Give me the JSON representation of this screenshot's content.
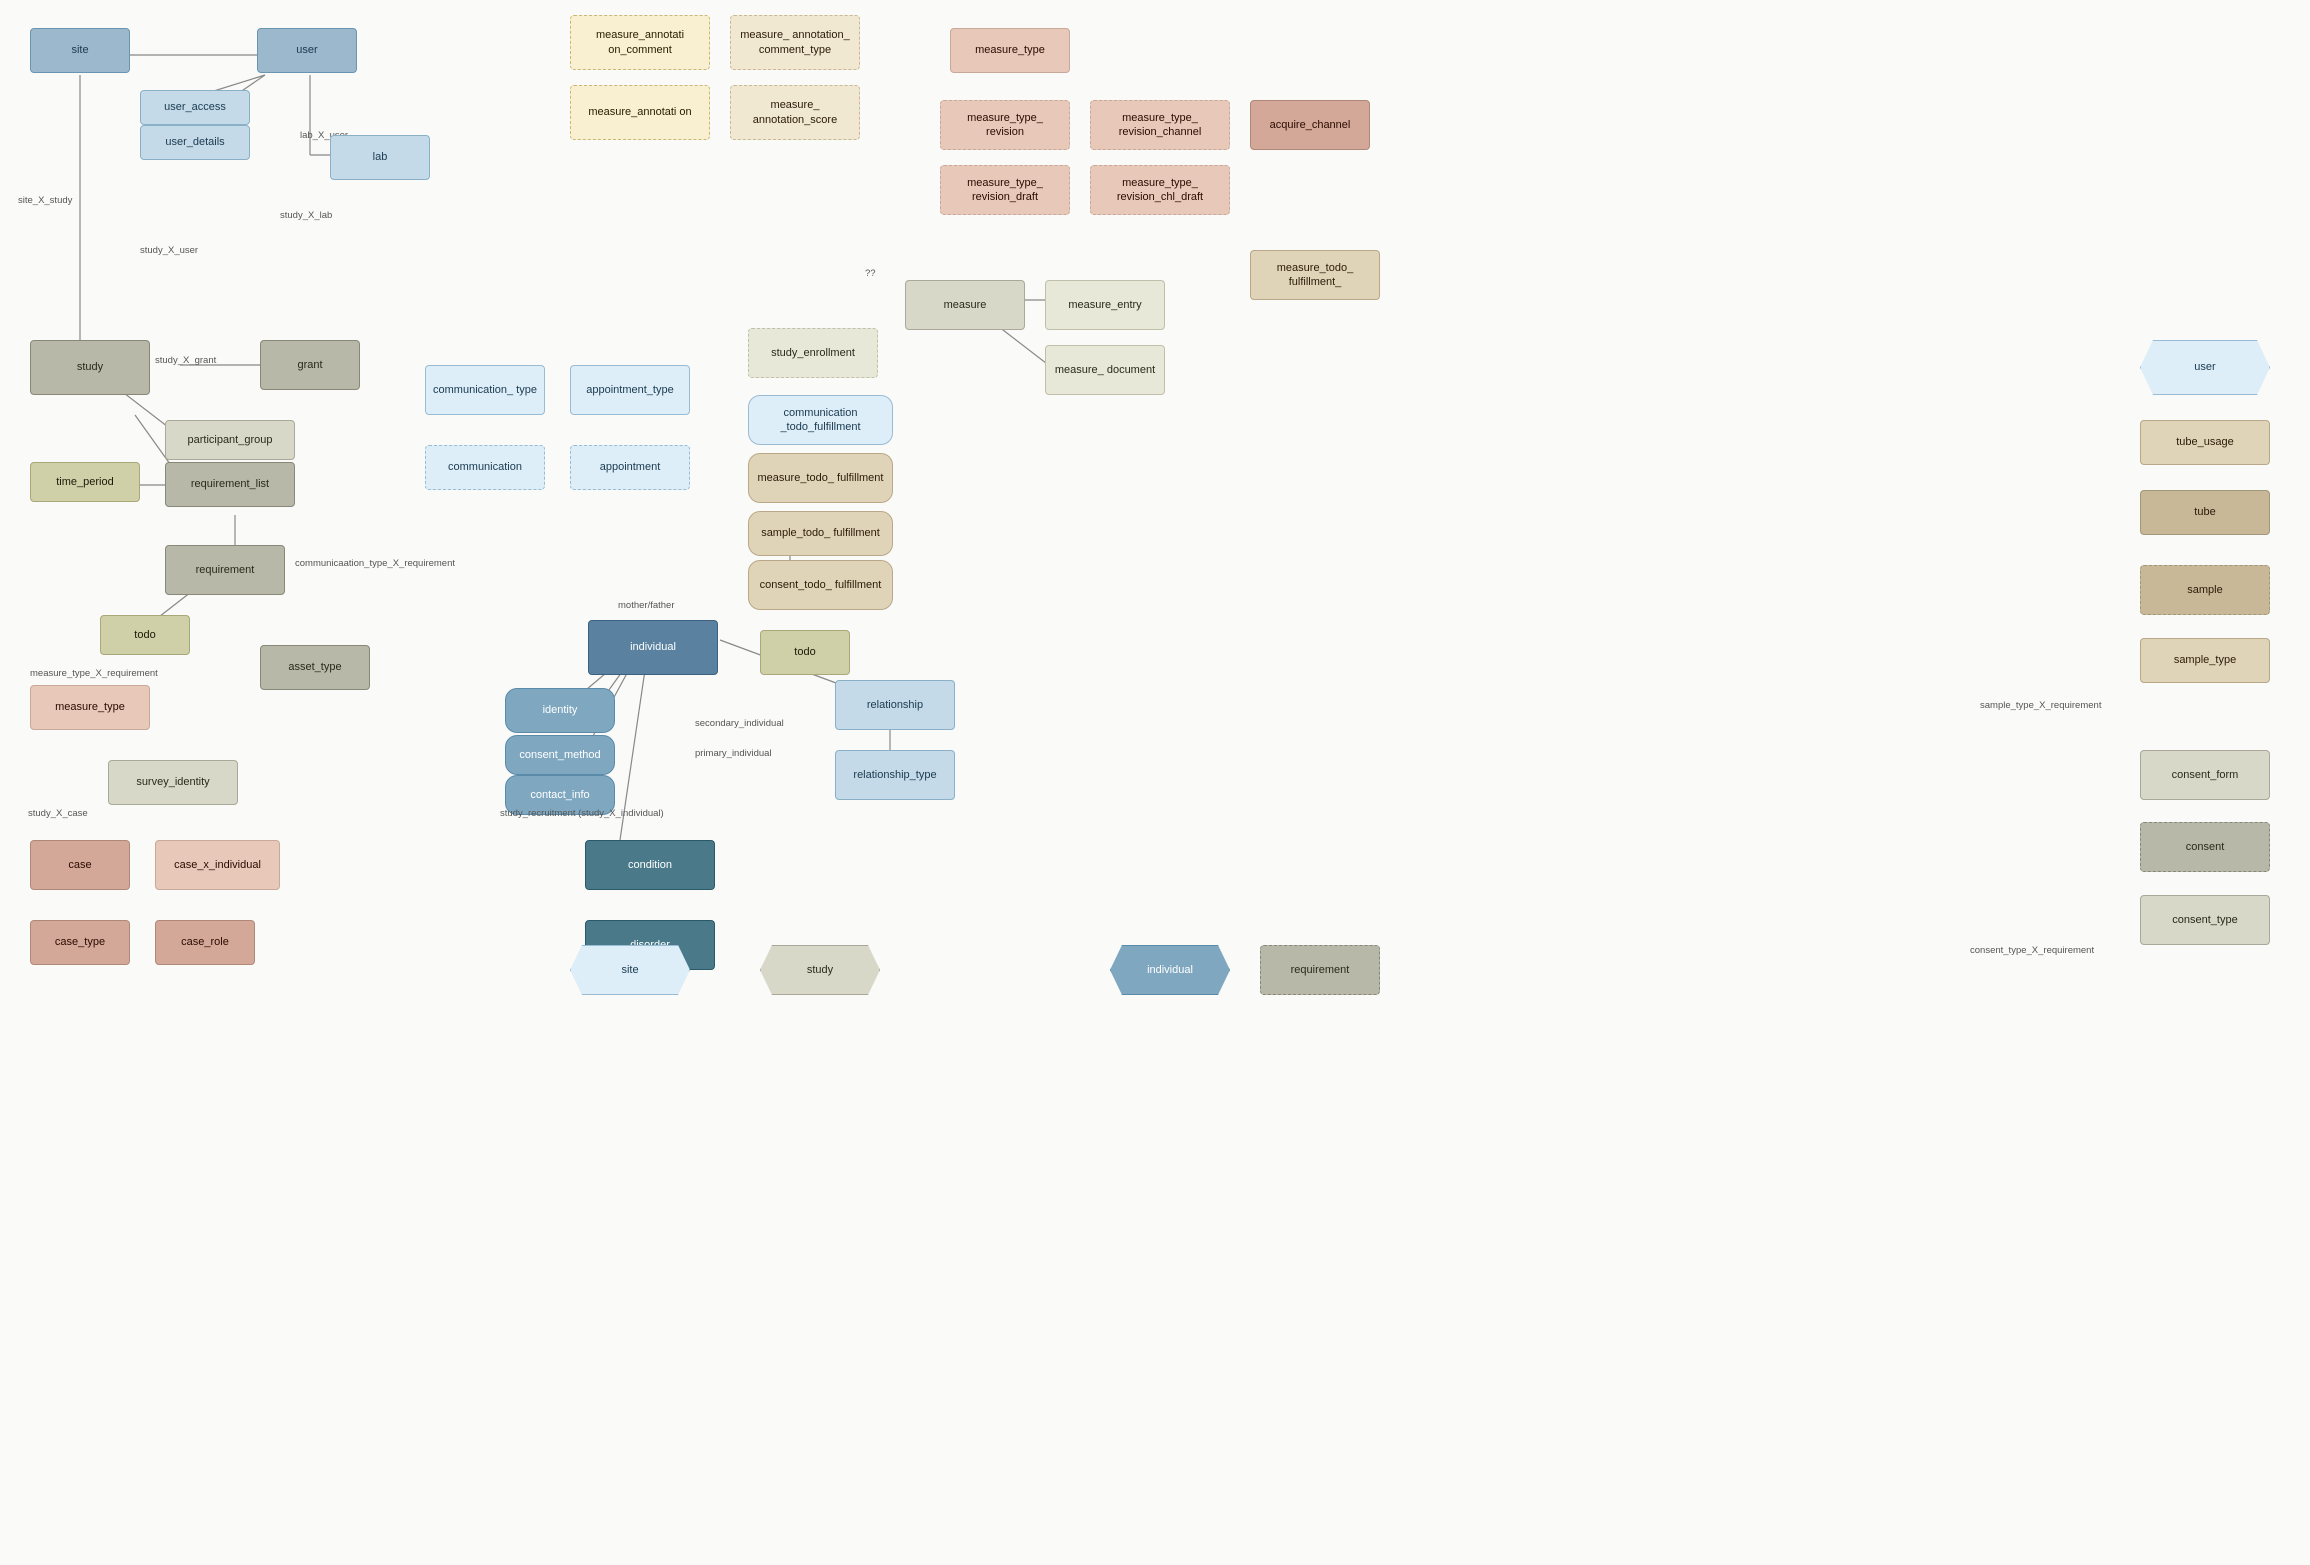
{
  "nodes": {
    "site": {
      "label": "site"
    },
    "user_top": {
      "label": "user"
    },
    "user_access": {
      "label": "user_access"
    },
    "user_details": {
      "label": "user_details"
    },
    "lab": {
      "label": "lab"
    },
    "measure_annotation_comment": {
      "label": "measure_annotati\non_comment"
    },
    "measure_annotation_comment_type": {
      "label": "measure_\nannotation_\ncomment_type"
    },
    "measure_annotation": {
      "label": "measure_annotati\non"
    },
    "measure_annotation_score": {
      "label": "measure_\nannotation_score"
    },
    "measure_type_top": {
      "label": "measure_type"
    },
    "measure_type_revision": {
      "label": "measure_type_\nrevision"
    },
    "measure_type_revision_channel": {
      "label": "measure_type_\nrevision_channel"
    },
    "acquire_channel": {
      "label": "acquire_channel"
    },
    "measure_type_revision_draft": {
      "label": "measure_type_\nrevision_draft"
    },
    "measure_type_revision_chl_draft": {
      "label": "measure_type_\nrevision_chl_draft"
    },
    "measure_todo_fulfillment_top": {
      "label": "measure_todo_\nfulfillment_"
    },
    "measure": {
      "label": "measure"
    },
    "measure_entry": {
      "label": "measure_entry"
    },
    "measure_document": {
      "label": "measure_\ndocument"
    },
    "study": {
      "label": "study"
    },
    "grant": {
      "label": "grant"
    },
    "participant_group": {
      "label": "participant_group"
    },
    "time_period": {
      "label": "time_period"
    },
    "requirement_list": {
      "label": "requirement_list"
    },
    "requirement": {
      "label": "requirement"
    },
    "todo_left": {
      "label": "todo"
    },
    "measure_type_left": {
      "label": "measure_type"
    },
    "asset_type": {
      "label": "asset_type"
    },
    "communication_type": {
      "label": "communication_\ntype"
    },
    "communication": {
      "label": "communication"
    },
    "appointment_type": {
      "label": "appointment_type"
    },
    "appointment": {
      "label": "appointment"
    },
    "study_enrollment": {
      "label": "study_enrollment"
    },
    "communication_todo_fulfillment": {
      "label": "communication\n_todo_fulfillment"
    },
    "measure_todo_fulfillment_center": {
      "label": "measure_todo_\nfulfillment"
    },
    "sample_todo_fulfillment": {
      "label": "sample_todo_\nfulfillment"
    },
    "consent_todo_fulfillment": {
      "label": "consent_todo_\nfulfillment"
    },
    "todo_center": {
      "label": "todo"
    },
    "individual": {
      "label": "individual"
    },
    "identity": {
      "label": "identity"
    },
    "consent_method": {
      "label": "consent_method"
    },
    "contact_info": {
      "label": "contact_info"
    },
    "relationship": {
      "label": "relationship"
    },
    "relationship_type": {
      "label": "relationship_type"
    },
    "condition": {
      "label": "condition"
    },
    "disorder": {
      "label": "disorder"
    },
    "site_legend": {
      "label": "site"
    },
    "study_legend": {
      "label": "study"
    },
    "individual_legend": {
      "label": "individual"
    },
    "requirement_legend": {
      "label": "requirement"
    },
    "survey_identity": {
      "label": "survey_identity"
    },
    "case": {
      "label": "case"
    },
    "case_x_individual": {
      "label": "case_x_individual"
    },
    "case_type": {
      "label": "case_type"
    },
    "case_role": {
      "label": "case_role"
    },
    "user_right": {
      "label": "user"
    },
    "tube_usage": {
      "label": "tube_usage"
    },
    "tube": {
      "label": "tube"
    },
    "sample": {
      "label": "sample"
    },
    "sample_type": {
      "label": "sample_type"
    },
    "consent_form": {
      "label": "consent_form"
    },
    "consent": {
      "label": "consent"
    },
    "consent_type": {
      "label": "consent_type"
    }
  },
  "labels": {
    "lab_x_user": "lab_X_user",
    "site_x_study": "site_X_study",
    "study_x_user": "study_X_user",
    "study_x_lab": "study_X_lab",
    "study_x_grant": "study_X_grant",
    "communication_type_x_requirement": "communicaation_type_X_requirement",
    "measure_type_x_requirement": "measure_type_X_requirement",
    "mother_father": "mother/father",
    "secondary_individual": "secondary_individual",
    "primary_individual": "primary_individual",
    "study_recruitment": "study_recruitment (study_X_individual)",
    "study_x_case": "study_X_case",
    "question_marks": "??",
    "sample_type_x_requirement": "sample_type_X_requirement",
    "consent_type_x_requirement": "consent_type_X_requirement"
  }
}
